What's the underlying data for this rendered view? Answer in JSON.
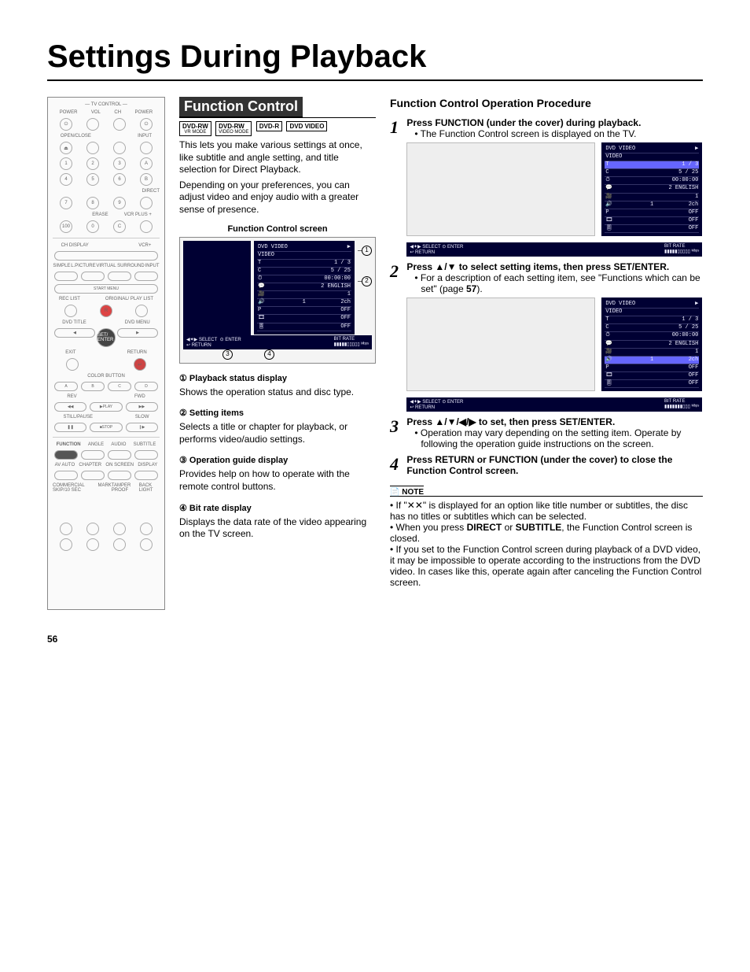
{
  "page": {
    "title": "Settings During Playback",
    "number": "56"
  },
  "remote": {
    "tv_control": "— TV CONTROL —",
    "power": "POWER",
    "vol": "VOL",
    "ch": "CH",
    "power2": "POWER",
    "open_close": "OPEN/CLOSE",
    "input": "INPUT",
    "direct": "DIRECT",
    "erase": "ERASE",
    "vcrplus": "VCR PLUS +",
    "ch_display": "CH DISPLAY",
    "simple": "SIMPLE",
    "lpicture": "L.PICTURE",
    "virtual": "VIRTUAL SURROUND",
    "input2": "INPUT",
    "start_menu": "START MENU",
    "rec_list": "REC LIST",
    "original": "ORIGINAL/ PLAY LIST",
    "dvd_title": "DVD TITLE",
    "dvd_menu": "DVD MENU",
    "exit": "EXIT",
    "return": "RETURN",
    "set_enter": "SET/ ENTER",
    "color": "COLOR BUTTON",
    "a": "A",
    "b": "B",
    "c": "C",
    "d": "D",
    "rev": "REV",
    "fwd": "FWD",
    "play": "▶PLAY",
    "still": "STILL/PAUSE",
    "slow": "SLOW",
    "stop": "■STOP",
    "function": "FUNCTION",
    "angle": "ANGLE",
    "audio": "AUDIO",
    "subtitle": "SUBTITLE",
    "av_auto": "AV AUTO",
    "chapter": "CHAPTER",
    "on_screen": "ON SCREEN",
    "display": "DISPLAY",
    "commercial": "COMMERCIAL SKIP/10 SEC",
    "mark": "MARK",
    "tamper": "TAMPER PROOF",
    "back": "BACK LIGHT"
  },
  "section": {
    "title": "Function Control",
    "badges": [
      {
        "top": "DVD-RW",
        "sub": "VR MODE"
      },
      {
        "top": "DVD-RW",
        "sub": "VIDEO MODE"
      },
      {
        "top": "DVD-R",
        "sub": ""
      },
      {
        "top": "DVD VIDEO",
        "sub": ""
      }
    ],
    "intro1": "This lets you make various settings at once, like subtitle and angle setting, and title selection for Direct Playback.",
    "intro2": "Depending on your preferences, you can adjust video and enjoy audio with a greater sense of presence.",
    "fc_screen_label": "Function Control screen",
    "osd": {
      "header1": "DVD VIDEO",
      "header2": "VIDEO",
      "r1": "1 / 3",
      "r2": "5 / 25",
      "r3": "00:00:00",
      "r4": "2 ENGLISH",
      "r5": "1",
      "r6": "1",
      "r6b": "2ch",
      "r7": "OFF",
      "r8": "OFF",
      "r9": "OFF",
      "select": "SELECT",
      "enter": "ENTER",
      "return": "RETURN",
      "bitrate": "BIT RATE"
    },
    "callouts": {
      "c1": "1",
      "c2": "2",
      "c3": "3",
      "c4": "4"
    },
    "item1": {
      "head": "① Playback status display",
      "body": "Shows the operation status and disc type."
    },
    "item2": {
      "head": "② Setting items",
      "body": "Selects a title or chapter for playback, or performs video/audio settings."
    },
    "item3": {
      "head": "③ Operation guide display",
      "body": "Provides help on how to operate with the remote control buttons."
    },
    "item4": {
      "head": "④ Bit rate display",
      "body": "Displays the data rate of the video appearing on the TV screen."
    }
  },
  "procedure": {
    "title": "Function Control Operation Procedure",
    "step1": {
      "head_a": "Press ",
      "head_b": "FUNCTION",
      "head_c": " (under the cover) during playback.",
      "b1": "The Function Control screen is displayed on the TV."
    },
    "step2": {
      "head_a": "Press ",
      "arrows": "▲/▼",
      "head_b": " to select setting items, then press ",
      "head_c": "SET/ENTER",
      "head_d": ".",
      "b1_a": "For a description of each setting item, see \"Functions which can be set\" (page ",
      "b1_page": "57",
      "b1_b": ")."
    },
    "step3": {
      "head_a": "Press ",
      "arrows": "▲/▼/◀/▶",
      "head_b": " to set, then press ",
      "head_c": "SET/ENTER",
      "head_d": ".",
      "b1": "Operation may vary depending on the setting item. Operate by following the operation guide instructions on the screen."
    },
    "step4": {
      "head_a": "Press ",
      "key1": "RETURN",
      "mid": " or ",
      "key2": "FUNCTION",
      "head_b": " (under the cover) to close the Function Control screen."
    },
    "note_label": "NOTE",
    "notes": {
      "n1": "If \"✕✕\" is displayed for an option like title number or subtitles, the disc has no titles or subtitles which can be selected.",
      "n2_a": "When you press ",
      "n2_b": "DIRECT",
      "n2_c": " or ",
      "n2_d": "SUBTITLE",
      "n2_e": ", the Function Control screen is closed.",
      "n3": "If you set to the Function Control screen during playback of a DVD video, it may be impossible to operate according to the instructions from the DVD video. In cases like this, operate again after canceling the Function Control screen."
    }
  }
}
